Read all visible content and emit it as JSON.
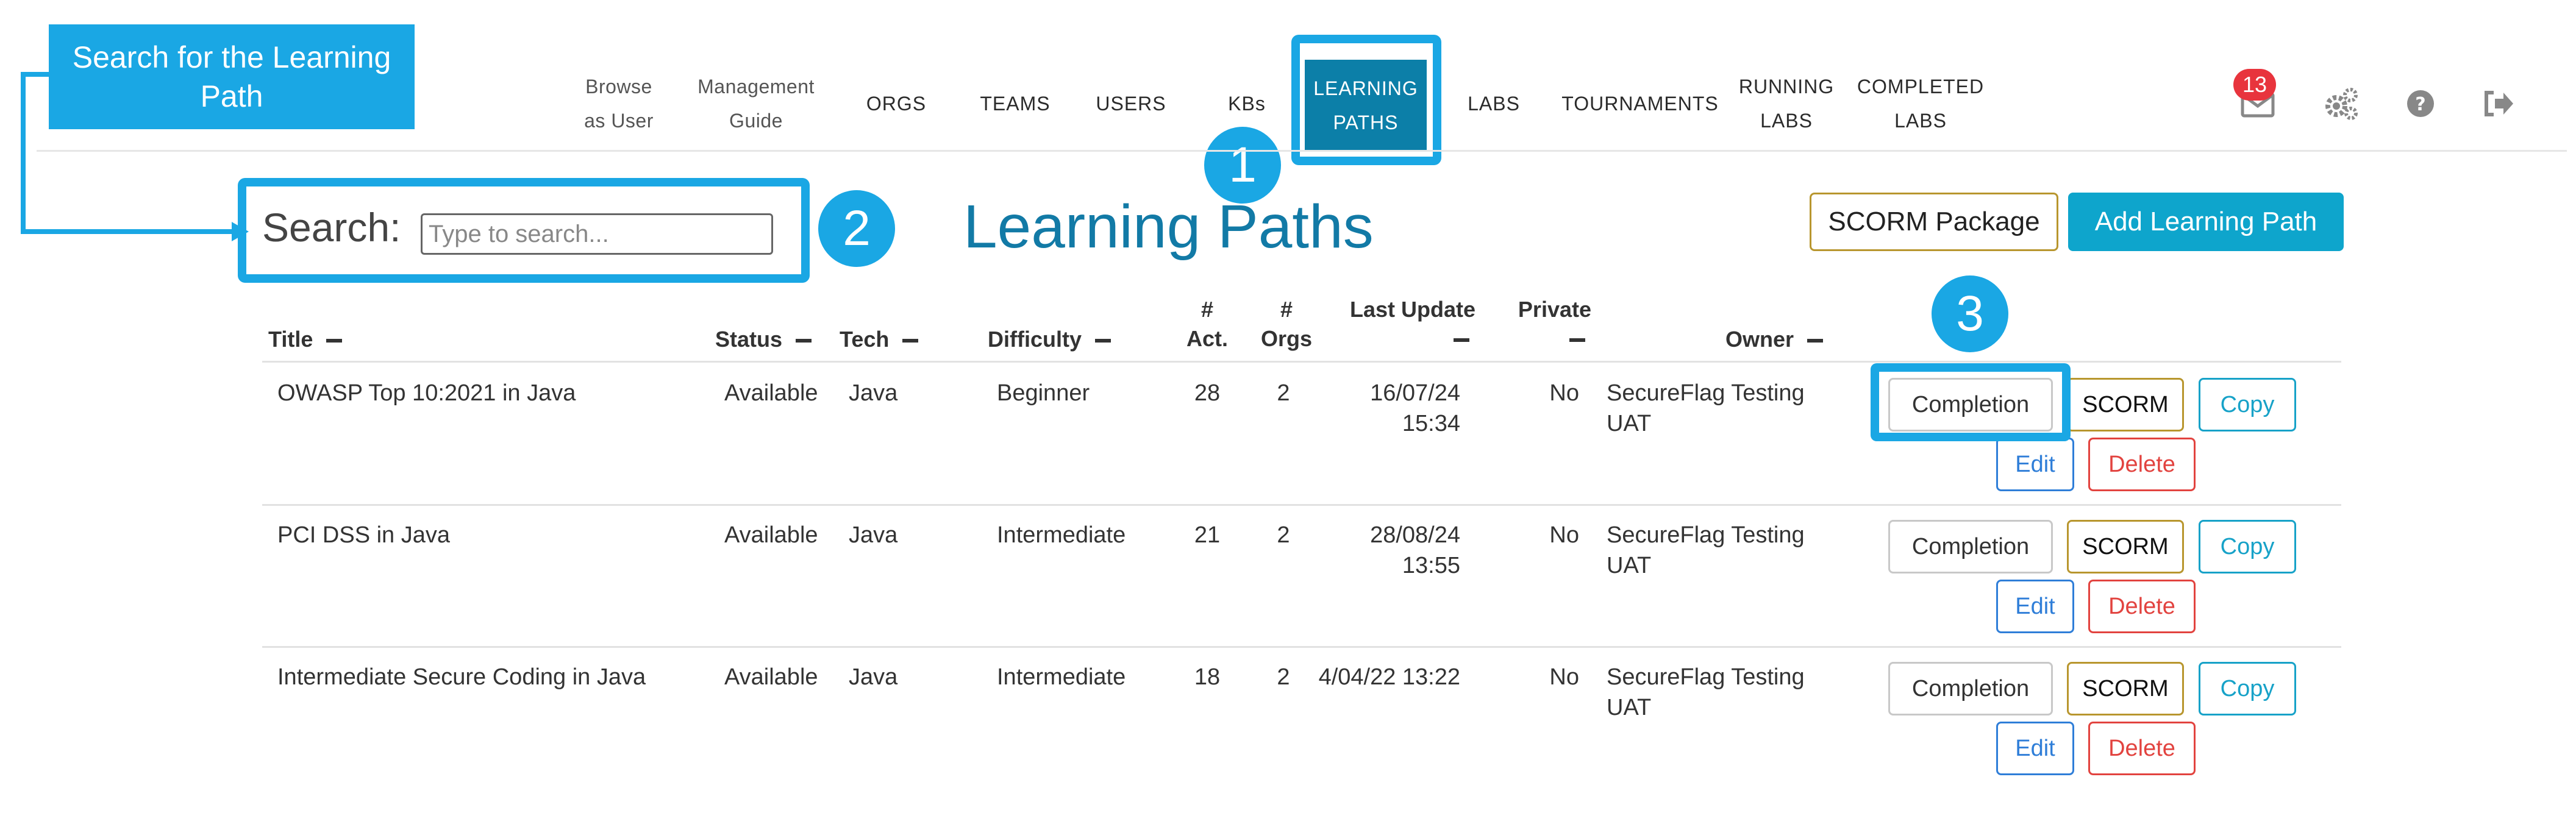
{
  "annotations": {
    "callout_text": "Search for the Learning Path",
    "step1": "1",
    "step2": "2",
    "step3": "3"
  },
  "nav": {
    "items": [
      {
        "line1": "Browse",
        "line2": "as User"
      },
      {
        "line1": "Management",
        "line2": "Guide"
      },
      {
        "line1": "ORGS"
      },
      {
        "line1": "TEAMS"
      },
      {
        "line1": "USERS"
      },
      {
        "line1": "KBs"
      },
      {
        "line1": "LEARNING",
        "line2": "PATHS"
      },
      {
        "line1": "LABS"
      },
      {
        "line1": "TOURNAMENTS"
      },
      {
        "line1": "RUNNING",
        "line2": "LABS"
      },
      {
        "line1": "COMPLETED",
        "line2": "LABS"
      }
    ],
    "mail_count": "13",
    "icons": [
      "mail-icon",
      "settings-gears-icon",
      "help-icon",
      "logout-icon"
    ]
  },
  "search": {
    "label": "Search:",
    "placeholder": "Type to search..."
  },
  "page": {
    "title": "Learning Paths",
    "scorm_package_label": "SCORM Package",
    "add_learning_path_label": "Add Learning Path"
  },
  "table": {
    "headers": {
      "title": "Title",
      "status": "Status",
      "tech": "Tech",
      "difficulty": "Difficulty",
      "act_hash": "#",
      "act": "Act.",
      "orgs_hash": "#",
      "orgs": "Orgs",
      "last_update": "Last Update",
      "private": "Private",
      "owner": "Owner"
    },
    "rows": [
      {
        "title": "OWASP Top 10:2021 in Java",
        "status": "Available",
        "tech": "Java",
        "difficulty": "Beginner",
        "act": "28",
        "orgs": "2",
        "last_update_date": "16/07/24",
        "last_update_time": "15:34",
        "private": "No",
        "owner_line1": "SecureFlag Testing",
        "owner_line2": "UAT"
      },
      {
        "title": "PCI DSS in Java",
        "status": "Available",
        "tech": "Java",
        "difficulty": "Intermediate",
        "act": "21",
        "orgs": "2",
        "last_update_date": "28/08/24",
        "last_update_time": "13:55",
        "private": "No",
        "owner_line1": "SecureFlag Testing",
        "owner_line2": "UAT"
      },
      {
        "title": "Intermediate Secure Coding in Java",
        "status": "Available",
        "tech": "Java",
        "difficulty": "Intermediate",
        "act": "18",
        "orgs": "2",
        "last_update_date": "4/04/22 13:22",
        "last_update_time": "",
        "private": "No",
        "owner_line1": "SecureFlag Testing",
        "owner_line2": "UAT"
      }
    ],
    "actions": {
      "completion": "Completion",
      "scorm": "SCORM",
      "copy": "Copy",
      "edit": "Edit",
      "delete": "Delete"
    }
  },
  "colors": {
    "accent": "#1aa7e4",
    "active_nav": "#0c7fa8",
    "title": "#127aa6",
    "add_button": "#0ea5cc",
    "scorm_border": "#b8962e",
    "delete": "#e2433f",
    "edit": "#2f7ed8",
    "badge": "#e8343d"
  }
}
